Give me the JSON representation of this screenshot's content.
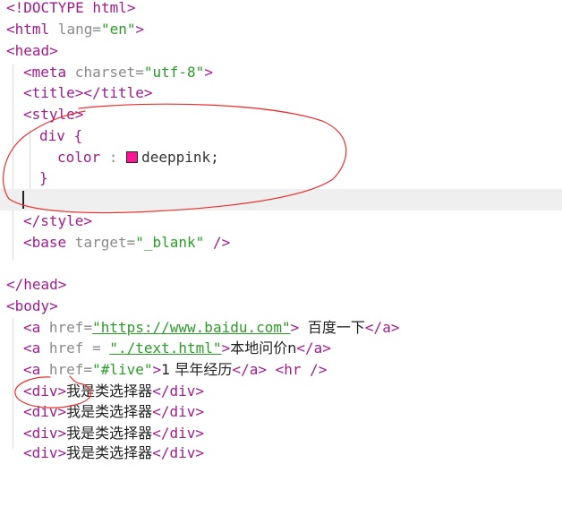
{
  "editor": {
    "colors": {
      "tag": "#a01c8d",
      "string": "#2a9c27",
      "punct": "#8a8a8a",
      "swatch": "#ff1493",
      "annotation": "#e8312f"
    },
    "lines": [
      {
        "t1": "<!DOCTYPE html>"
      },
      {
        "t1": "<html",
        "a1": " lang",
        "p1": "=",
        "s1": "\"en\"",
        "t2": ">"
      },
      {
        "t1": "<head>"
      },
      {
        "t1": "<meta",
        "a1": " charset",
        "p1": "=",
        "s1": "\"utf-8\"",
        "t2": ">"
      },
      {
        "t1": "<title></title>"
      },
      {
        "t1": "<style>"
      },
      {
        "t1": "div {"
      },
      {
        "p1": "color",
        "p2": " : ",
        "v1": "deeppink;"
      },
      {
        "t1": "}"
      },
      {
        "t1": ""
      },
      {
        "t1": "</style>"
      },
      {
        "t1": "<base",
        "a1": " target",
        "p1": "=",
        "s1": "\"_blank\"",
        "t2": " />"
      },
      {
        "t1": ""
      },
      {
        "t1": "</head>"
      },
      {
        "t1": "<body>"
      },
      {
        "t1": "<a",
        "a1": " href",
        "p1": "=",
        "s1": "\"https://www.baidu.com\"",
        "t2": "> ",
        "c1": "百度一下",
        "t3": "</a>"
      },
      {
        "t1": "<a",
        "a1": " href ",
        "p1": "= ",
        "s1": "\"./text.html\"",
        "t2": ">",
        "c1": "本地问价n",
        "t3": "</a>"
      },
      {
        "t1": "<a",
        "a1": " href",
        "p1": "=",
        "s1": "\"#live\"",
        "t2": ">",
        "c1": "1 早年经历",
        "t3": "</a>",
        "t4": " <hr />"
      },
      {
        "t1": "<div>",
        "c1": "我是类选择器",
        "t2": "</div>"
      },
      {
        "t1": "<div>",
        "c1": "我是类选择器",
        "t2": "</div>"
      },
      {
        "t1": "<div>",
        "c1": "我是类选择器",
        "t2": "</div>"
      },
      {
        "t1": "<div>",
        "c1": "我是类选择器",
        "t2": "</div>"
      }
    ]
  }
}
